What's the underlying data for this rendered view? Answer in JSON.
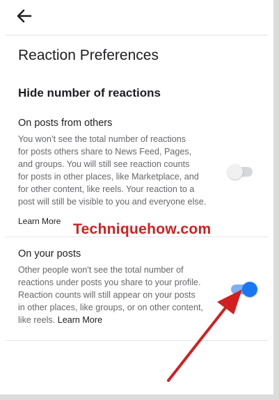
{
  "header": {
    "back_icon": "arrow-left-icon"
  },
  "page": {
    "title": "Reaction Preferences"
  },
  "section": {
    "title": "Hide number of reactions"
  },
  "others": {
    "heading": "On posts from others",
    "description_lines": [
      "You won’t see the total number of reactions",
      "for posts others share to News Feed, Pages,",
      "and groups. You will still see reaction counts",
      "for posts in other places, like Marketplace, and",
      "for other content, like reels. Your reaction to a",
      "post will still be visible to you and everyone else."
    ],
    "learn_more": "Learn More",
    "toggle_on": false
  },
  "yours": {
    "heading": "On your posts",
    "description_lines": [
      "Other people won't see the total number of",
      "reactions under posts you share to your profile.",
      "Reaction counts will still appear on your posts",
      "in other places, like groups, or on other content,"
    ],
    "last_line_prefix": "like reels. ",
    "learn_more": "Learn More",
    "toggle_on": true
  },
  "watermark": "Techniquehow.com",
  "colors": {
    "accent": "#1877f2",
    "annotation_red": "#d21f1f"
  }
}
